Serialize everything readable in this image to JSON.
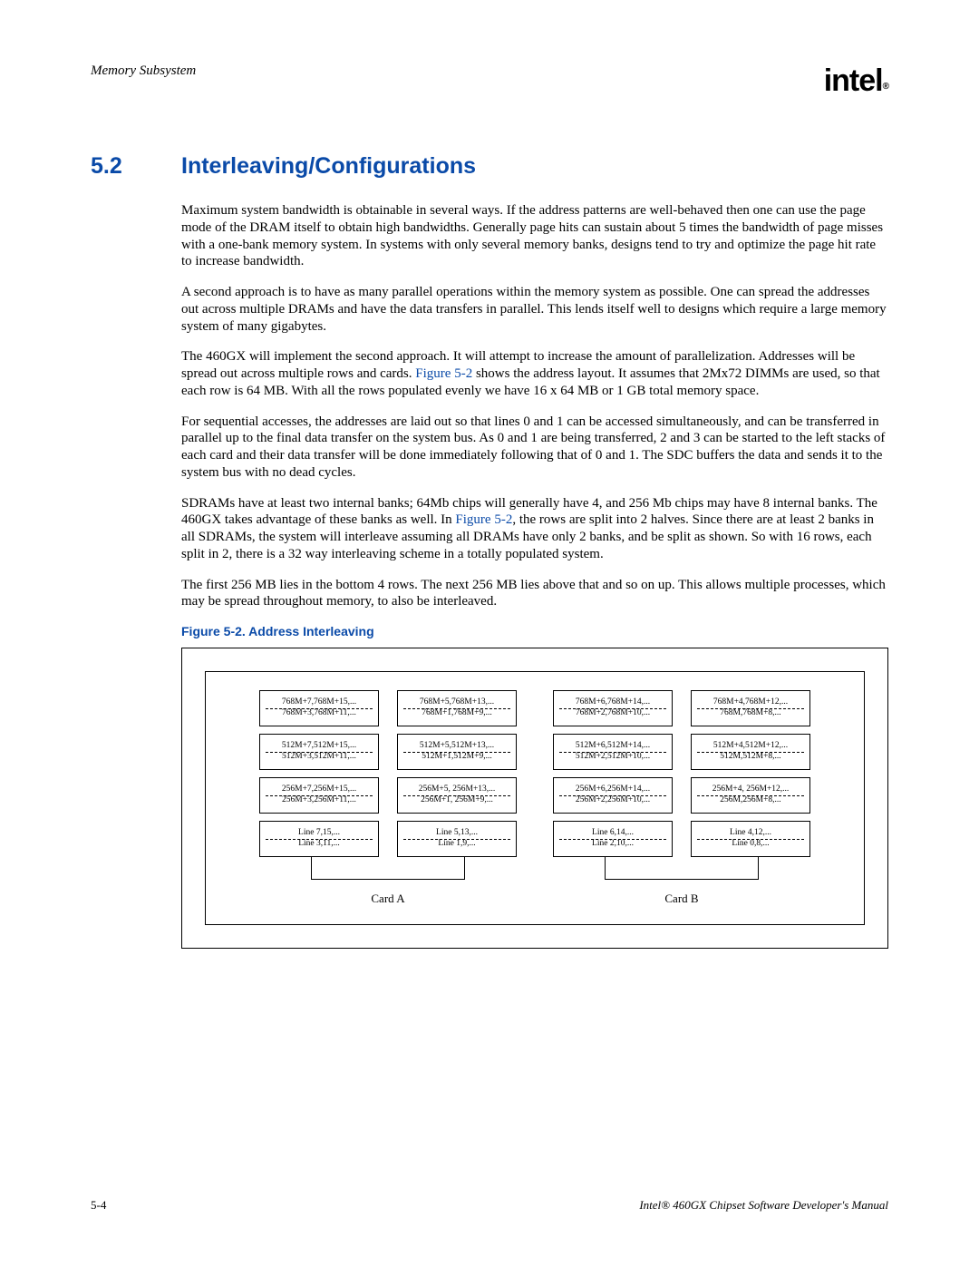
{
  "header": {
    "section_label": "Memory Subsystem",
    "logo_text": "intel",
    "logo_r": "®"
  },
  "section": {
    "number": "5.2",
    "title": "Interleaving/Configurations"
  },
  "paragraphs": {
    "p1": "Maximum system bandwidth is obtainable in several ways. If the address patterns are well-behaved then one can use the page mode of the DRAM itself to obtain high bandwidths. Generally page hits can sustain about 5 times the bandwidth of page misses with a one-bank memory system. In systems with only several memory banks, designs tend to try and optimize the page hit rate to increase bandwidth.",
    "p2": "A second approach is to have as many parallel operations within the memory system as possible. One can spread the addresses out across multiple DRAMs and have the data transfers in parallel. This lends itself well to designs which require a large memory system of many gigabytes.",
    "p3a": "The 460GX will implement the second approach. It will attempt to increase the amount of parallelization. Addresses will be spread out across multiple rows and cards. ",
    "p3_link": "Figure 5-2",
    "p3b": " shows the address layout. It assumes that 2Mx72 DIMMs are used, so that each row is 64 MB. With all the rows populated evenly we have 16 x 64 MB or 1 GB total memory space.",
    "p4": "For sequential accesses, the addresses are laid out so that lines 0 and 1 can be accessed simultaneously, and can be transferred in parallel up to the final data transfer on the system bus. As 0 and 1 are being transferred, 2 and 3 can be started to the left stacks of each card and their data transfer will be done immediately following that of 0 and 1. The SDC buffers the data and sends it to the system bus with no dead cycles.",
    "p5a": "SDRAMs have at least two internal banks; 64Mb chips will generally have 4, and 256 Mb chips may have 8 internal banks. The 460GX takes advantage of these banks as well. In ",
    "p5_link": "Figure 5-2",
    "p5b": ", the rows are split into 2 halves. Since there are at least 2 banks in all SDRAMs, the system will interleave assuming all DRAMs have only 2 banks, and be split as shown.   So with 16 rows, each split in 2, there is a 32 way interleaving scheme in a totally populated system.",
    "p6": "The first 256 MB lies in the bottom 4 rows. The next 256 MB lies above that and so on up. This allows multiple processes, which may be spread throughout memory, to also be interleaved."
  },
  "figure": {
    "caption": "Figure 5-2. Address Interleaving",
    "cardA_label": "Card A",
    "cardB_label": "Card B",
    "cardA_left": [
      {
        "top": "768M+7,768M+15,...",
        "bottom": "768M+3,768M+11,..."
      },
      {
        "top": "512M+7,512M+15,...",
        "bottom": "512M+3,512M+11,..."
      },
      {
        "top": "256M+7,256M+15,...",
        "bottom": "256M+3,256M+11,..."
      },
      {
        "top": "Line 7,15,...",
        "bottom": "Line 3,11,..."
      }
    ],
    "cardA_right": [
      {
        "top": "768M+5,768M+13,...",
        "bottom": "768M+1,768M+9,..."
      },
      {
        "top": "512M+5,512M+13,...",
        "bottom": "512M+1,512M+9,..."
      },
      {
        "top": "256M+5, 256M+13,...",
        "bottom": "256M+1, 256M+9,..."
      },
      {
        "top": "Line 5,13,...",
        "bottom": "Line 1,9,..."
      }
    ],
    "cardB_left": [
      {
        "top": "768M+6,768M+14,...",
        "bottom": "768M+2,768M+10,..."
      },
      {
        "top": "512M+6,512M+14,...",
        "bottom": "512M+2,512M+10,..."
      },
      {
        "top": "256M+6,256M+14,...",
        "bottom": "256M+2,256M+10,..."
      },
      {
        "top": "Line 6,14,...",
        "bottom": "Line 2,10,..."
      }
    ],
    "cardB_right": [
      {
        "top": "768M+4,768M+12,...",
        "bottom": "768M,768M+8,..."
      },
      {
        "top": "512M+4,512M+12,...",
        "bottom": "512M,512M+8,..."
      },
      {
        "top": "256M+4, 256M+12,...",
        "bottom": "256M,256M+8,..."
      },
      {
        "top": "Line 4,12,...",
        "bottom": "Line 0,8,..."
      }
    ]
  },
  "footer": {
    "page_num": "5-4",
    "manual_title": "Intel® 460GX Chipset Software Developer's Manual"
  }
}
